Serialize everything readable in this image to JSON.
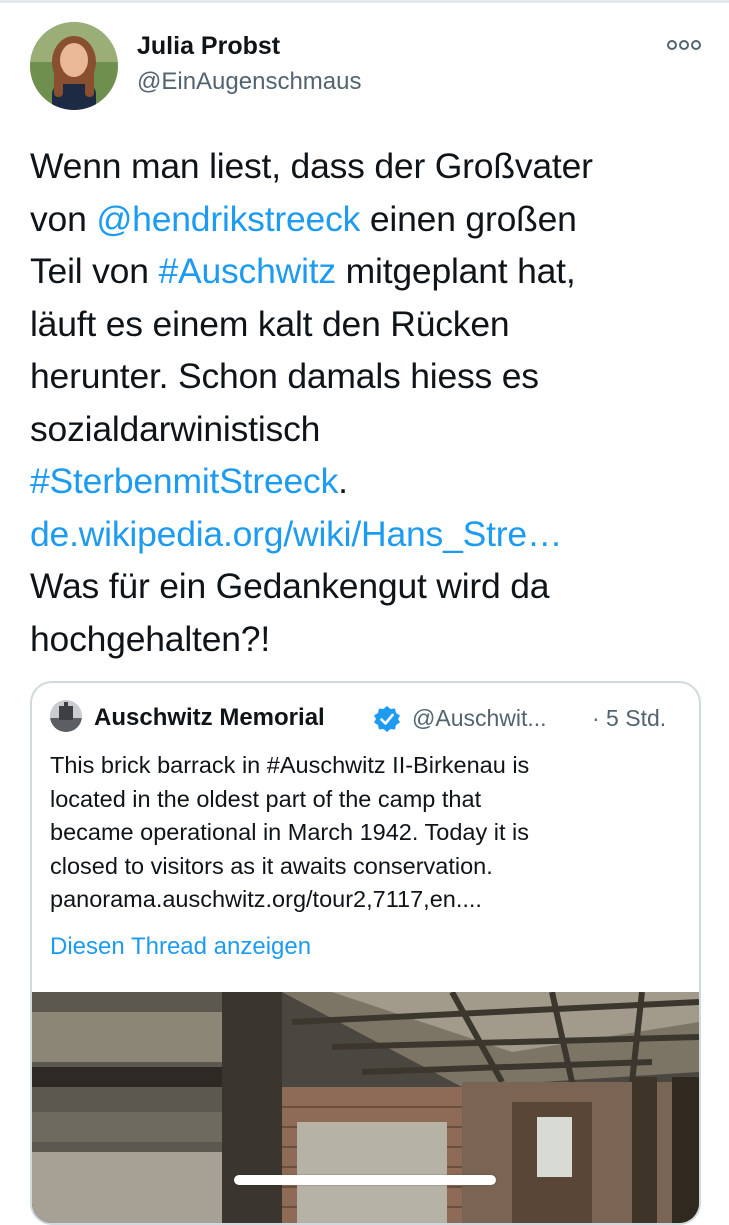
{
  "tweet": {
    "author_name": "Julia Probst",
    "author_handle": "@EinAugenschmaus",
    "avatar_icon": "user-avatar-photo",
    "more_icon": "more-options-icon",
    "lines": [
      [
        {
          "t": "Wenn man liest, dass der Großvater"
        }
      ],
      [
        {
          "t": "von "
        },
        {
          "t": "@hendrikstreeck",
          "link": true
        },
        {
          "t": " einen großen"
        }
      ],
      [
        {
          "t": "Teil von "
        },
        {
          "t": "#Auschwitz",
          "link": true
        },
        {
          "t": " mitgeplant hat,"
        }
      ],
      [
        {
          "t": "läuft es einem kalt den Rücken"
        }
      ],
      [
        {
          "t": "herunter. Schon damals hiess es"
        }
      ],
      [
        {
          "t": "sozialdarwinistisch"
        }
      ],
      [
        {
          "t": "#SterbenmitStreeck",
          "link": true
        },
        {
          "t": "."
        }
      ],
      [
        {
          "t": "de.wikipedia.org/wiki/Hans_Stre…",
          "link": true
        }
      ],
      [
        {
          "t": "Was für ein Gedankengut wird da"
        }
      ],
      [
        {
          "t": "hochgehalten?!"
        }
      ]
    ]
  },
  "quote": {
    "author_name": "Auschwitz Memorial",
    "verified_icon": "verified-badge-icon",
    "author_handle": "@Auschwit...",
    "time": "· 5 Std.",
    "text_lines": [
      "This brick barrack in #Auschwitz II-Birkenau is",
      "located in the oldest part of the camp that",
      "became operational in March 1942. Today it is",
      "closed to visitors as it awaits conservation.",
      "panorama.auschwitz.org/tour2,7117,en...."
    ],
    "show_thread": "Diesen Thread anzeigen",
    "image_icon": "barrack-interior-photo"
  },
  "colors": {
    "link": "#1d9bf0",
    "text": "#0f1419",
    "secondary": "#536471",
    "border": "#cfd9de",
    "verified": "#1d9bf0"
  }
}
